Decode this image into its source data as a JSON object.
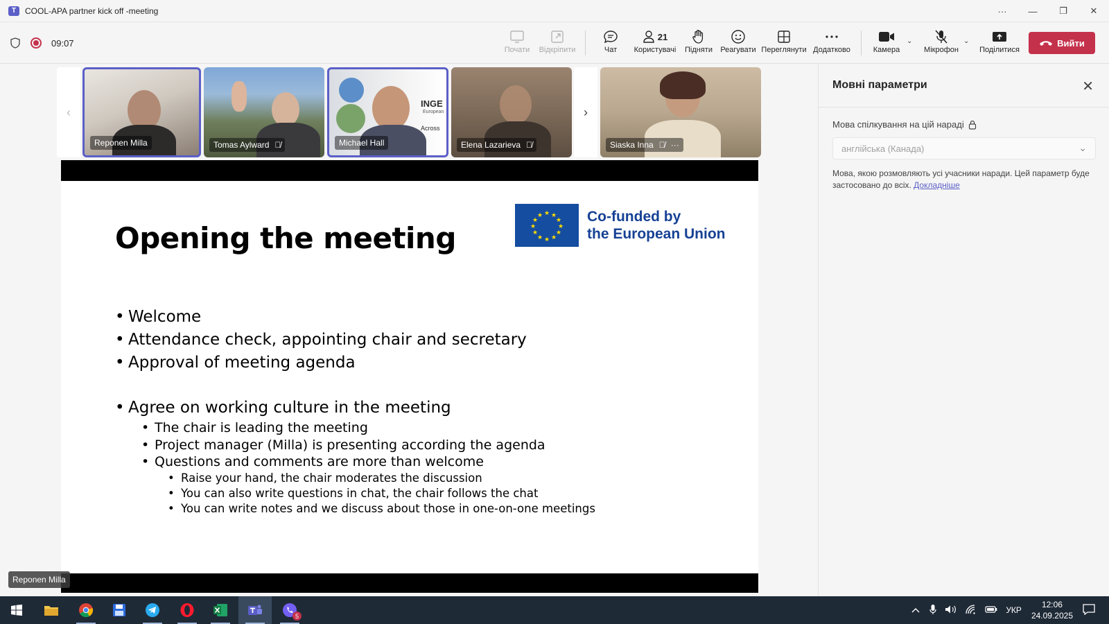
{
  "window": {
    "title": "COOL-APA partner kick off -meeting",
    "more": "···",
    "minimize": "—",
    "restore": "❐",
    "close": "✕"
  },
  "toolbar": {
    "timer": "09:07",
    "buttons": {
      "start": "Почати",
      "unpin": "Відкріпити",
      "chat": "Чат",
      "people": "Користувачі",
      "people_count": "21",
      "raise": "Підняти",
      "react": "Реагувати",
      "view": "Переглянути",
      "more": "Додатково",
      "camera": "Камера",
      "mic": "Мікрофон",
      "share": "Поділитися"
    },
    "leave": "Вийти"
  },
  "participants": [
    {
      "name": "Reponen Milla",
      "muted": false,
      "active": true
    },
    {
      "name": "Tomas Aylward",
      "muted": true,
      "active": false
    },
    {
      "name": "Michael Hall",
      "muted": false,
      "active": true
    },
    {
      "name": "Elena Lazarieva",
      "muted": true,
      "active": false
    },
    {
      "name": "Siaska Inna",
      "muted": true,
      "active": false,
      "more": "···"
    }
  ],
  "participant_bg_text": {
    "inge": "INGE",
    "european": "European",
    "across": "Across"
  },
  "slide": {
    "title": "Opening the meeting",
    "eu_logo_line1": "Co-funded by",
    "eu_logo_line2": "the European Union",
    "bullets_l1a": [
      "Welcome",
      "Attendance check, appointing chair and secretary",
      "Approval of meeting agenda"
    ],
    "bullet_l1b": "Agree on working culture in the meeting",
    "bullets_l2": [
      "The chair is leading the meeting",
      "Project manager (Milla) is presenting according the agenda",
      "Questions and comments are more than welcome"
    ],
    "bullets_l3": [
      "Raise your hand, the chair moderates the discussion",
      "You can also write questions in chat, the chair follows the chat",
      "You can write notes and we discuss about those in one-on-one meetings"
    ]
  },
  "presenter_tag": "Reponen Milla",
  "panel": {
    "title": "Мовні параметри",
    "label": "Мова спілкування на цій нараді",
    "select_value": "англійська (Канада)",
    "description": "Мова, якою розмовляють усі учасники наради. Цей параметр буде застосовано до всіх.",
    "link": "Докладніше"
  },
  "taskbar": {
    "viber_badge": "5",
    "lang": "УКР",
    "time": "12:06",
    "date": "24.09.2025"
  },
  "colors": {
    "accent": "#5b5fc7",
    "leave": "#c4314b",
    "eu_blue": "#154da0",
    "taskbar": "#1f2a37"
  }
}
